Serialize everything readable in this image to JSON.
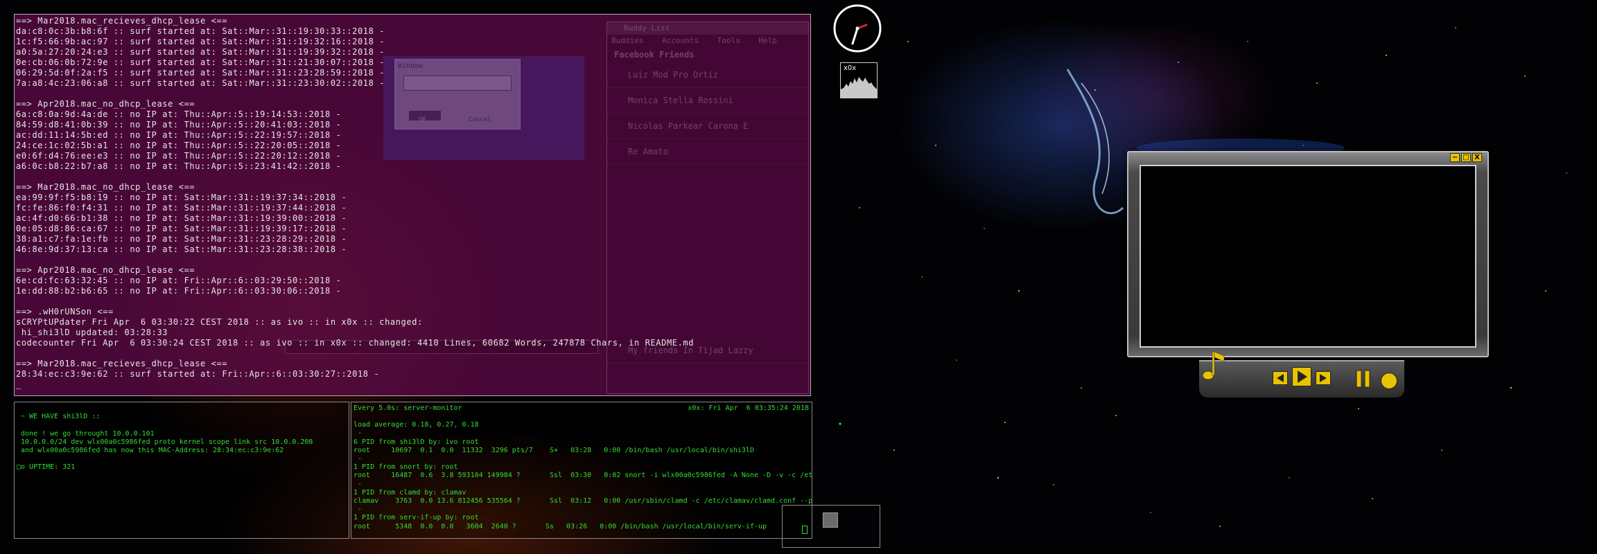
{
  "main_terminal": {
    "lines": [
      "==> Mar2018.mac_recieves_dhcp_lease <==",
      "da:c8:0c:3b:b8:6f :: surf started at: Sat::Mar::31::19:30:33::2018 -",
      "1c:f5:66:9b:ac:97 :: surf started at: Sat::Mar::31::19:32:16::2018 -",
      "a0:5a:27:20:24:e3 :: surf started at: Sat::Mar::31::19:39:32::2018 -",
      "0e:cb:06:0b:72:9e :: surf started at: Sat::Mar::31::21:30:07::2018 -",
      "06:29:5d:0f:2a:f5 :: surf started at: Sat::Mar::31::23:28:59::2018 -",
      "7a:a8:4c:23:06:a8 :: surf started at: Sat::Mar::31::23:30:02::2018 -",
      "",
      "==> Apr2018.mac_no_dhcp_lease <==",
      "6a:c8:0a:9d:4a:de :: no IP at: Thu::Apr::5::19:14:53::2018 -",
      "84:59:d8:41:0b:39 :: no IP at: Thu::Apr::5::20:41:03::2018 -",
      "ac:dd:11:14:5b:ed :: no IP at: Thu::Apr::5::22:19:57::2018 -",
      "24:ce:1c:02:5b:a1 :: no IP at: Thu::Apr::5::22:20:05::2018 -",
      "e0:6f:d4:76:ee:e3 :: no IP at: Thu::Apr::5::22:20:12::2018 -",
      "a6:0c:b8:22:b7:a8 :: no IP at: Thu::Apr::5::23:41:42::2018 -",
      "",
      "==> Mar2018.mac_no_dhcp_lease <==",
      "ea:99:9f:f5:b8:19 :: no IP at: Sat::Mar::31::19:37:34::2018 -",
      "fc:fe:86:f0:f4:31 :: no IP at: Sat::Mar::31::19:37:44::2018 -",
      "ac:4f:d0:66:b1:38 :: no IP at: Sat::Mar::31::19:39:00::2018 -",
      "0e:05:d8:86:ca:67 :: no IP at: Sat::Mar::31::19:39:17::2018 -",
      "38:a1:c7:fa:1e:fb :: no IP at: Sat::Mar::31::23:28:29::2018 -",
      "46:8e:9d:37:13:ca :: no IP at: Sat::Mar::31::23:28:38::2018 -",
      "",
      "==> Apr2018.mac_no_dhcp_lease <==",
      "6e:cd:fc:63:32:45 :: no IP at: Fri::Apr::6::03:29:50::2018 -",
      "1e:dd:88:b2:b6:65 :: no IP at: Fri::Apr::6::03:30:06::2018 -",
      "",
      "==> .wH0rUNSon <==",
      "sCRYPtUPdater Fri Apr  6 03:30:22 CEST 2018 :: as ivo :: in x0x :: changed:",
      " hi_shi3lD updated: 03:28:33",
      "codecounter Fri Apr  6 03:30:24 CEST 2018 :: as ivo :: in x0x :: changed: 4410 Lines, 60682 Words, 247878 Chars, in README.md",
      "",
      "==> Mar2018.mac_recieves_dhcp_lease <==",
      "28:34:ec:c3:9e:62 :: surf started at: Fri::Apr::6::03:30:27::2018 -",
      "_"
    ]
  },
  "ghost_buddy_list": {
    "title": "Buddy List",
    "menu": "Buddies Accounts Tools Help",
    "section": "Facebook Friends",
    "rows": [
      "Luiz Mod Pro Ortiz",
      "Monica Stella Rossini",
      "Nicolas Parkear Carona E",
      "Re Amato"
    ],
    "footer": "My friends In Tijad Lazzy"
  },
  "ghost_dialog": {
    "title": "Window",
    "ok": "OK",
    "cancel": "Cancel"
  },
  "left_terminal": {
    "lines": [
      "",
      " ~ WE HAVE shi3lD ::",
      "",
      " done ! we go throught 10.0.0.101",
      " 10.0.0.0/24 dev wlx00a0c5986fed proto kernel scope link src 10.0.0.208",
      " and wlx00a0c5986fed has now this MAC-Address: 28:34:ec:c3:9e:62",
      "",
      "□o UPTIME: 321"
    ]
  },
  "right_terminal": {
    "header": "Every 5.0s: server-monitor",
    "status": "x0x: Fri Apr  6 03:35:24 2018",
    "lines": [
      "",
      "load average: 0.18, 0.27, 0.18",
      " -",
      "6 PID from shi3lD by: ivo root",
      "root     10697  0.1  0.0  11332  3296 pts/7    S+   03:28   0:00 /bin/bash /usr/local/bin/shi3lD",
      " -",
      "1 PID from snort by: root",
      "root     16487  0.6  3.8 593104 149984 ?       Ssl  03:30   0:02 snort -i wlx00a0c5986fed -A None -D -v -c /et",
      " -",
      "1 PID from clamd by: clamav",
      "clamav    3763  0.0 13.6 812456 535564 ?       Ssl  03:12   0:00 /usr/sbin/clamd -c /etc/clamav/clamd.conf --p",
      " -",
      "1 PID from serv-if-up by: root",
      "root      5348  0.0  0.0   3604  2640 ?       Ss   03:26   0:00 /bin/bash /usr/local/bin/serv-if-up"
    ]
  },
  "cpu_graph": {
    "label": "x0x"
  },
  "player": {
    "minimize": "−",
    "maximize": "□",
    "close": "X"
  },
  "colors": {
    "terminal_bg": "#5c0a46",
    "terminal_text": "#e6e6e6",
    "monitor_text": "#33dd33",
    "player_accent": "#e8c300"
  },
  "icons": {
    "clock": "clock-icon",
    "music": "music-note-icon",
    "prev": "previous-icon",
    "play": "play-icon",
    "next": "next-icon",
    "pause": "pause-icon",
    "stop": "stop-icon"
  }
}
